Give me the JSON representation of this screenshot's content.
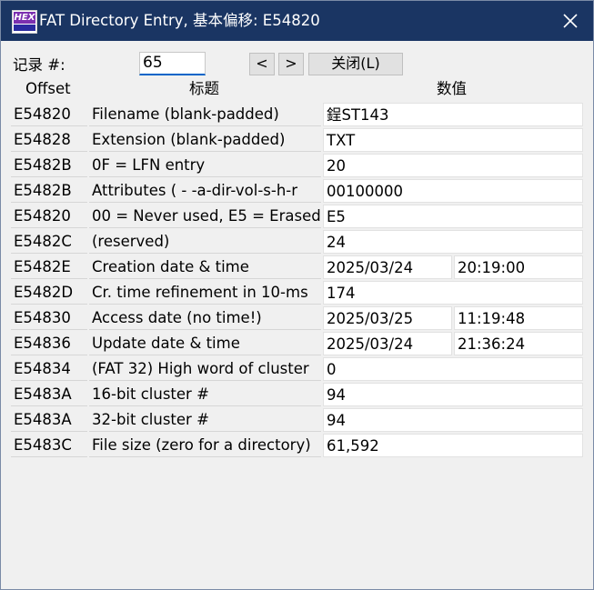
{
  "window": {
    "title": "FAT Directory Entry, 基本偏移: E54820",
    "icon_text": "HEX",
    "icon_name": "hex-editor-app-icon",
    "close_icon": "close-icon"
  },
  "record": {
    "label": "记录 #:",
    "value": "65",
    "prev_label": "<",
    "next_label": ">",
    "close_label": "关闭(L)"
  },
  "columns": {
    "offset": "Offset",
    "title": "标题",
    "value": "数值"
  },
  "rows": [
    {
      "offset": "E54820",
      "title": "Filename (blank-padded)",
      "value": "鋥ST143"
    },
    {
      "offset": "E54828",
      "title": "Extension (blank-padded)",
      "value": "TXT"
    },
    {
      "offset": "E5482B",
      "title": "0F = LFN entry",
      "value": "20"
    },
    {
      "offset": "E5482B",
      "title": "Attributes ( - -a-dir-vol-s-h-r",
      "value": "00100000"
    },
    {
      "offset": "E54820",
      "title": "00 = Never used, E5 = Erased",
      "value": "E5"
    },
    {
      "offset": "E5482C",
      "title": "(reserved)",
      "value": "24"
    },
    {
      "offset": "E5482E",
      "title": "Creation date & time",
      "value": "2025/03/24",
      "value2": "20:19:00"
    },
    {
      "offset": "E5482D",
      "title": "Cr. time refinement in 10-ms",
      "value": "174"
    },
    {
      "offset": "E54830",
      "title": "Access date (no time!)",
      "value": "2025/03/25",
      "value2": "11:19:48"
    },
    {
      "offset": "E54836",
      "title": "Update date & time",
      "value": "2025/03/24",
      "value2": "21:36:24"
    },
    {
      "offset": "E54834",
      "title": "(FAT 32) High word of cluster",
      "value": "0"
    },
    {
      "offset": "E5483A",
      "title": "16-bit cluster #",
      "value": "94"
    },
    {
      "offset": "E5483A",
      "title": "32-bit cluster #",
      "value": "94"
    },
    {
      "offset": "E5483C",
      "title": "File size (zero for a directory)",
      "value": "61,592"
    }
  ],
  "colors": {
    "titlebar": "#1a3563",
    "dialog_bg": "#f0f0f0",
    "input_focus": "#0064c8"
  }
}
